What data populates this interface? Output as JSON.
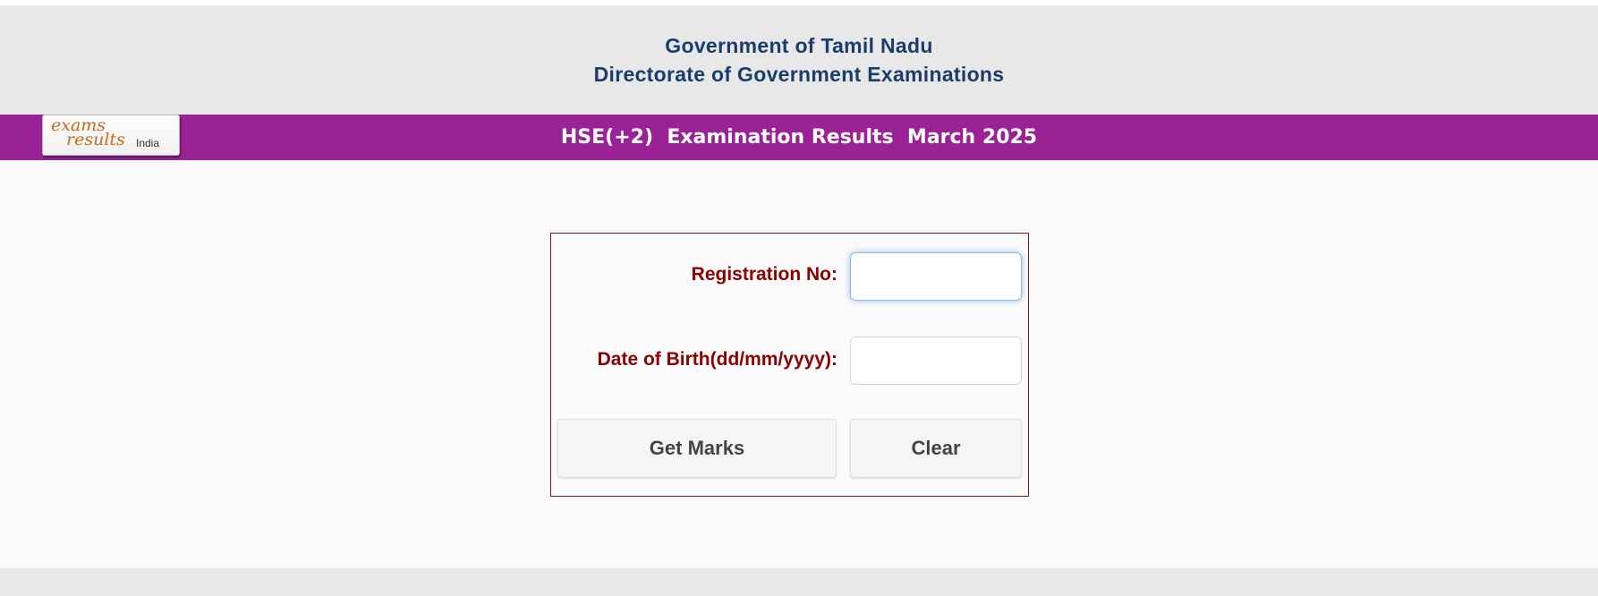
{
  "header": {
    "line1": "Government of Tamil Nadu",
    "line2": "Directorate of Government Examinations"
  },
  "band": {
    "title": "HSE(+2)  Examination Results  March 2025",
    "color": "#9b2196"
  },
  "logo": {
    "word1": "exams",
    "word2": "results",
    "word3": "India"
  },
  "form": {
    "reg_label": "Registration No:",
    "reg_value": "",
    "dob_label_bold": "Date of Birth",
    "dob_label_normal": "(dd/mm/yyyy):",
    "dob_value": "",
    "get_marks_label": "Get Marks",
    "clear_label": "Clear"
  },
  "colors": {
    "header_text": "#1a3d6b",
    "label_text": "#8b0000",
    "header_bg": "#e8e8e8"
  }
}
